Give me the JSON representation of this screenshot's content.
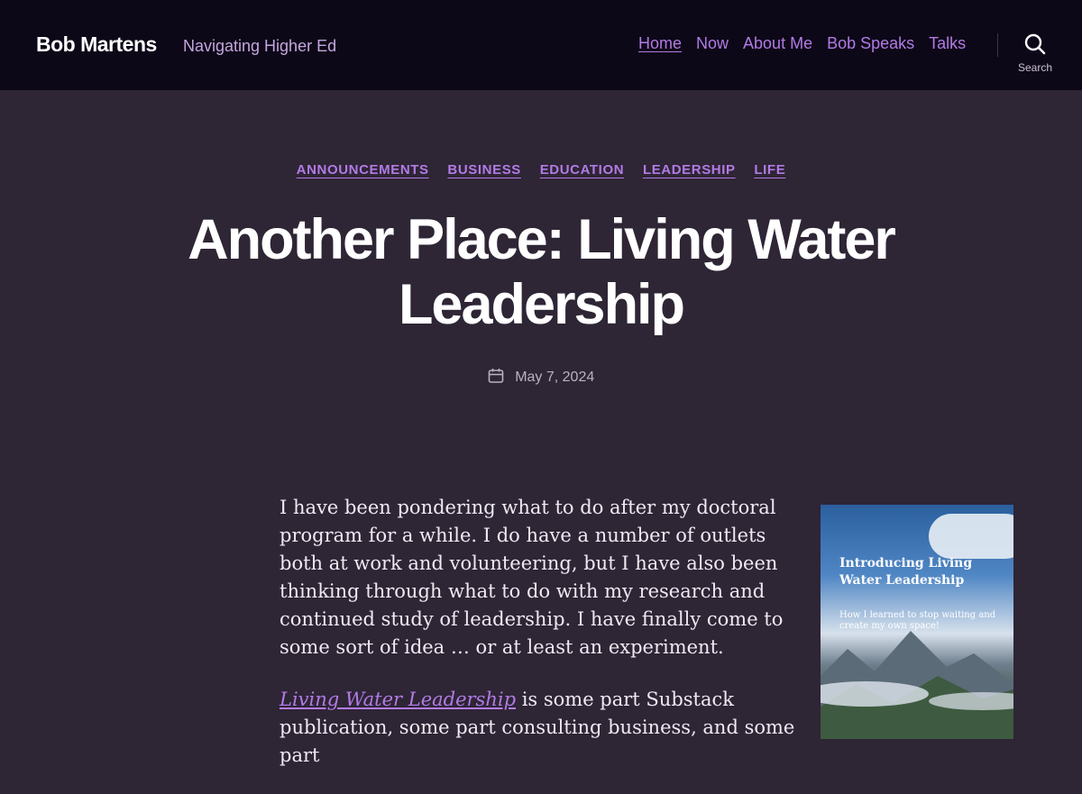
{
  "header": {
    "site_title": "Bob Martens",
    "tagline": "Navigating Higher Ed",
    "nav": [
      {
        "label": "Home"
      },
      {
        "label": "Now"
      },
      {
        "label": "About Me"
      },
      {
        "label": "Bob Speaks"
      },
      {
        "label": "Talks"
      }
    ],
    "search_label": "Search",
    "search_icon": "search-icon"
  },
  "post": {
    "categories": [
      "ANNOUNCEMENTS",
      "BUSINESS",
      "EDUCATION",
      "LEADERSHIP",
      "LIFE"
    ],
    "title": "Another Place: Living Water Leadership",
    "date": "May 7, 2024",
    "date_icon": "calendar-icon",
    "paragraph1": "I have been pondering what to do after my doctoral program for a while. I do have a number of outlets both at work and volunteering, but I have also been thinking through what to do with my research and continued study of leadership. I have finally come to some sort of idea … or at least an experiment.",
    "paragraph2_link": "Living Water Leadership",
    "paragraph2_text": " is some part Substack publication, some part consulting business, and some part",
    "cover": {
      "title": "Introducing Living Water Leadership",
      "subtitle": "How I learned to stop waiting and create my own space!"
    }
  },
  "colors": {
    "header_bg": "#0d0818",
    "page_bg": "#2e2535",
    "accent": "#b27be5"
  }
}
